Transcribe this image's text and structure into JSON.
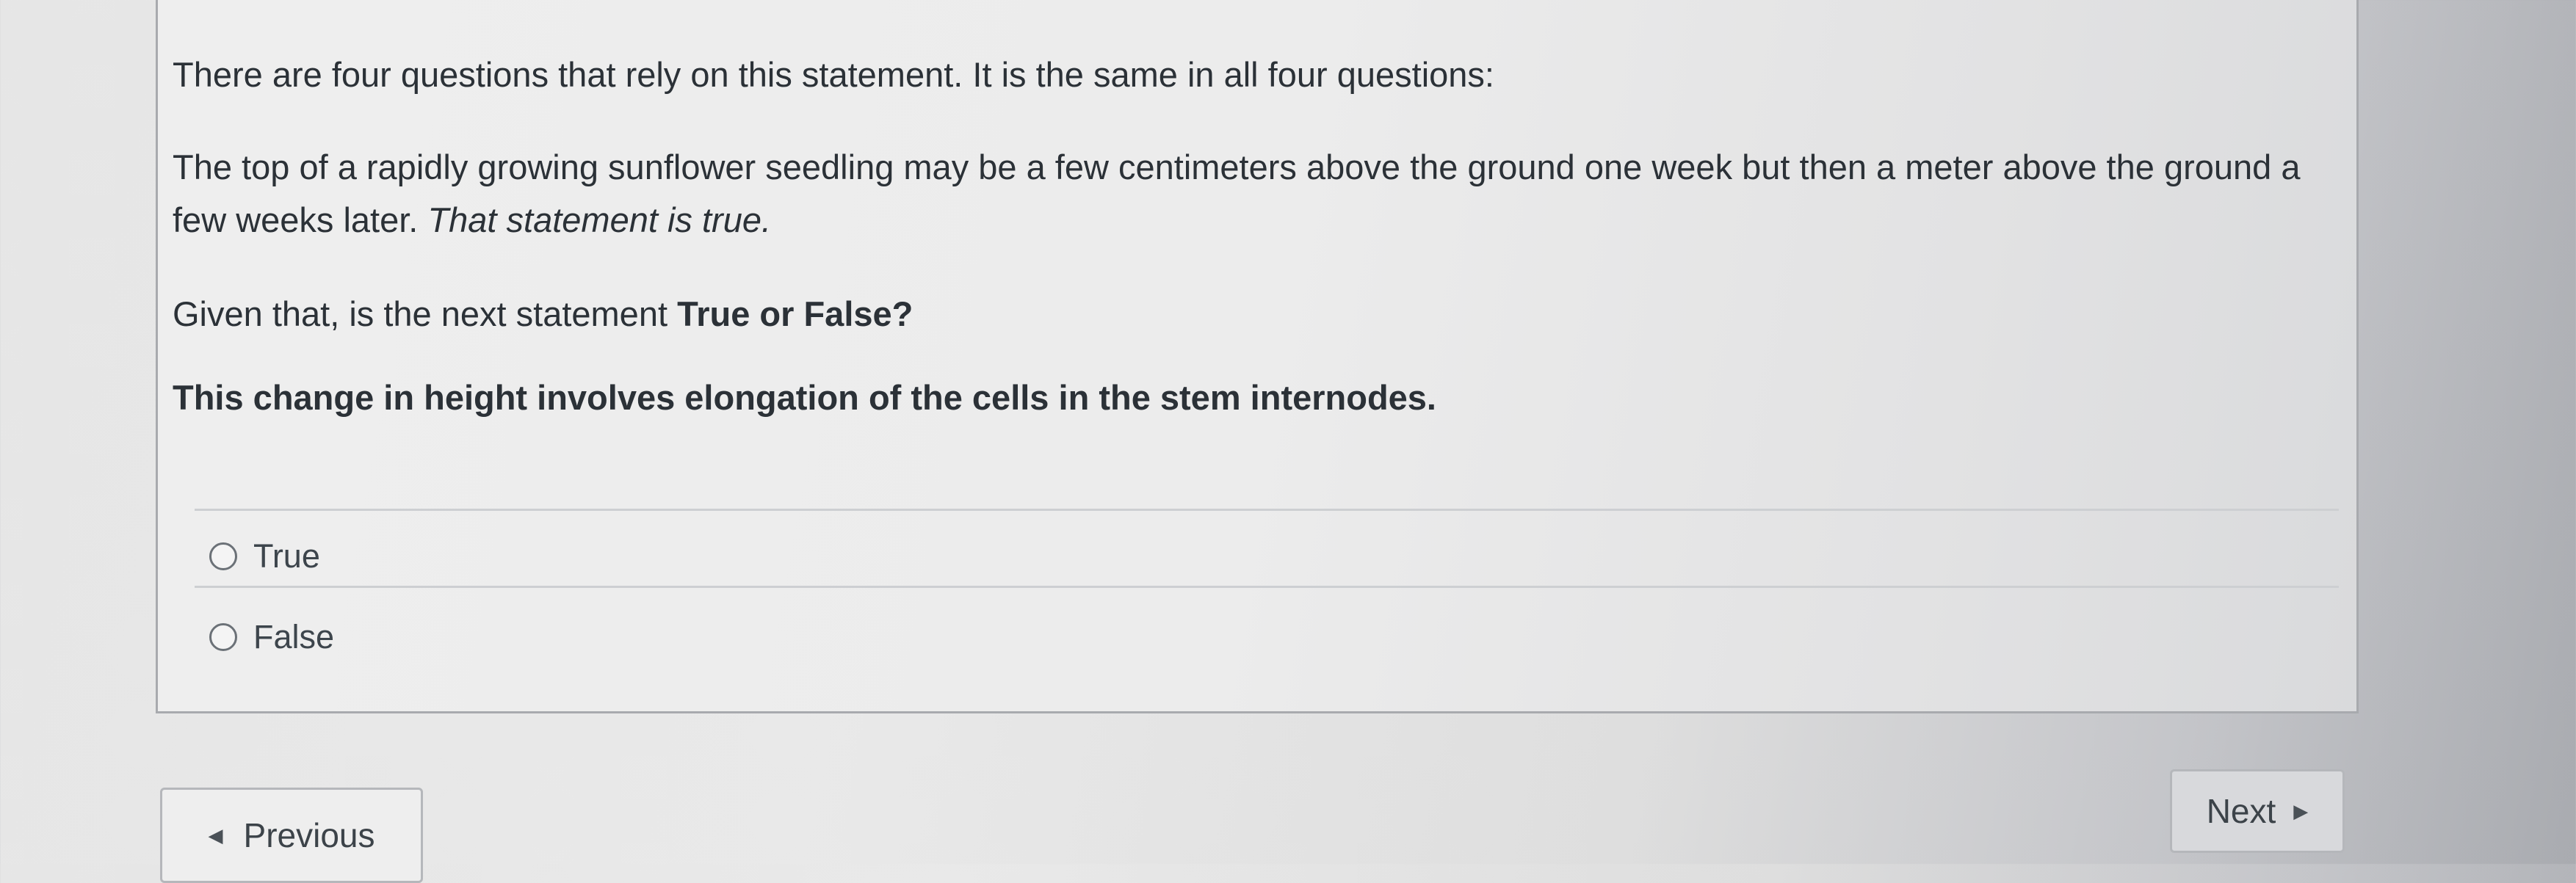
{
  "question": {
    "intro": "There are four questions that rely on this statement. It is the same in all four questions:",
    "statement": "The top of a rapidly growing sunflower seedling may be a few centimeters above the ground one week but then a meter above the ground a few weeks later.",
    "statement_emphasis": "That statement is true.",
    "given_prefix": "Given that, is the next statement",
    "given_bold": "True or False?",
    "prompt": "This change in height involves elongation of the cells in the stem internodes."
  },
  "answers": [
    {
      "label": "True",
      "selected": false
    },
    {
      "label": "False",
      "selected": false
    }
  ],
  "navigation": {
    "previous_label": "Previous",
    "next_label": "Next",
    "previous_icon": "triangle-left-icon",
    "next_icon": "triangle-right-icon"
  }
}
